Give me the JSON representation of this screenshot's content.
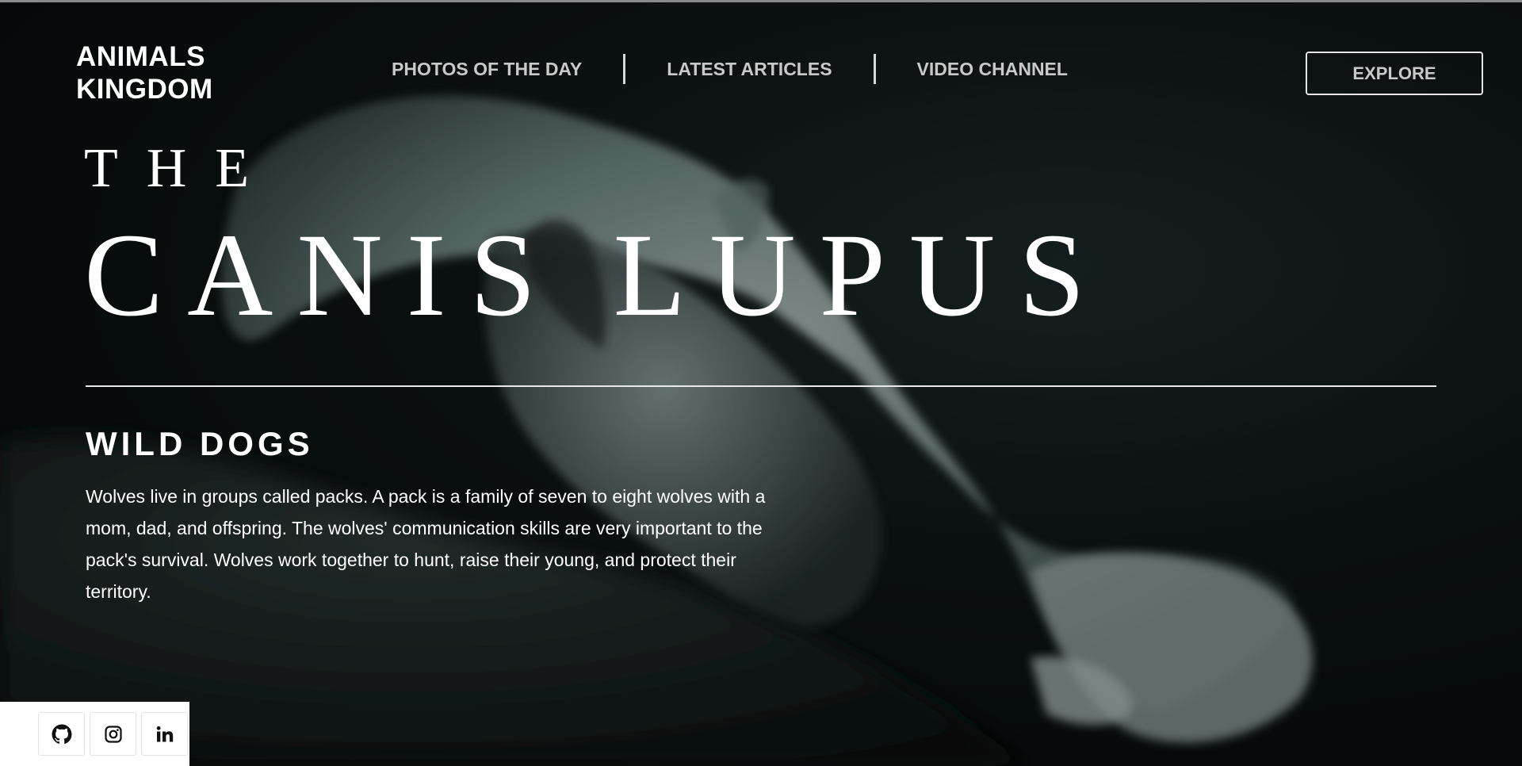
{
  "brand": {
    "line1": "ANIMALS",
    "line2": "KINGDOM"
  },
  "nav": {
    "items": [
      {
        "label": "PHOTOS OF THE DAY"
      },
      {
        "label": "LATEST ARTICLES"
      },
      {
        "label": "VIDEO CHANNEL"
      }
    ]
  },
  "explore": {
    "label": "EXPLORE"
  },
  "hero": {
    "pre_title": "THE",
    "title": "CANIS LUPUS",
    "subtitle": "WILD DOGS",
    "description": "Wolves live in groups called packs. A pack is a family of seven to eight wolves with a mom, dad, and offspring. The wolves' communication skills are very important to the pack's survival. Wolves work together to hunt, raise their young, and protect their territory."
  },
  "social": {
    "icons": [
      "github-icon",
      "instagram-icon",
      "linkedin-icon"
    ]
  },
  "colors": {
    "background": "#0a1010",
    "text": "#ffffff",
    "nav_text": "#c9c9c9",
    "image_tint": "#6f8f8c"
  }
}
